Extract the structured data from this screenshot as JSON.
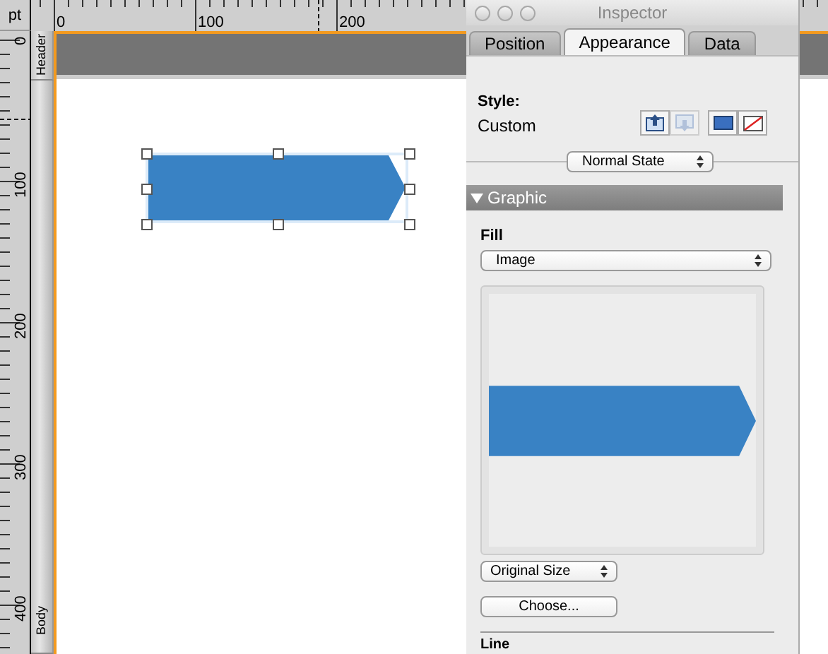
{
  "rulers": {
    "unit": "pt",
    "horizontal": [
      "0",
      "100",
      "200"
    ],
    "vertical": [
      "0",
      "100",
      "200",
      "300",
      "400"
    ]
  },
  "bands": [
    {
      "label": "Header",
      "kind": "header"
    },
    {
      "label": "Body",
      "kind": "body"
    }
  ],
  "shape": {
    "selected": true
  },
  "inspector": {
    "title": "Inspector",
    "tabs": [
      {
        "label": "Position",
        "selected": false
      },
      {
        "label": "Appearance",
        "selected": true
      },
      {
        "label": "Data",
        "selected": false
      }
    ],
    "style_label": "Style:",
    "style_value": "Custom",
    "style_button_groups": [
      [
        {
          "kind": "up",
          "disabled": false
        },
        {
          "kind": "down",
          "disabled": true
        }
      ],
      [
        {
          "kind": "fill",
          "disabled": false
        },
        {
          "kind": "none",
          "disabled": false
        }
      ]
    ],
    "state_popup": "Normal State",
    "graphic": {
      "title": "Graphic",
      "expanded": true,
      "fill_label": "Fill",
      "fill_popup": "Image",
      "size_popup": "Original Size",
      "choose_button": "Choose..."
    },
    "next_section": "Line"
  }
}
